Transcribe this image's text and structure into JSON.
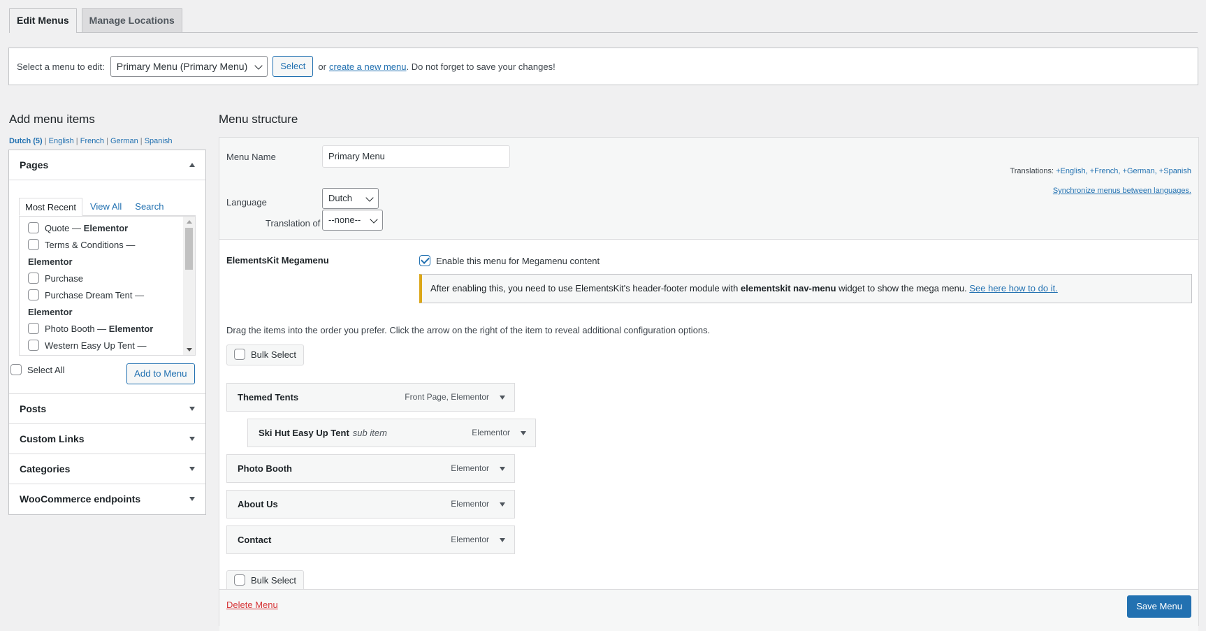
{
  "tabs": [
    {
      "label": "Edit Menus",
      "active": true
    },
    {
      "label": "Manage Locations",
      "active": false
    }
  ],
  "select_bar": {
    "label": "Select a menu to edit:",
    "selected_menu": "Primary Menu (Primary Menu)",
    "select_button": "Select",
    "or_text": "or",
    "create_link": "create a new menu",
    "reminder": ". Do not forget to save your changes!"
  },
  "left": {
    "title": "Add menu items",
    "languages": {
      "current": "Dutch (5)",
      "others": [
        "English",
        "French",
        "German",
        "Spanish"
      ]
    },
    "pages": {
      "title": "Pages",
      "tabs": [
        "Most Recent",
        "View All",
        "Search"
      ],
      "items": [
        {
          "text": "Quote",
          "suffix": "Elementor"
        },
        {
          "text": "Terms & Conditions —",
          "suffix": "Elementor"
        },
        {
          "text": "Purchase",
          "suffix": ""
        },
        {
          "text": "Purchase Dream Tent —",
          "suffix": "Elementor"
        },
        {
          "text": "Photo Booth",
          "suffix": "Elementor"
        },
        {
          "text": "Western Easy Up Tent —",
          "suffix": ""
        }
      ],
      "select_all": "Select All",
      "add_button": "Add to Menu"
    },
    "panels": [
      "Posts",
      "Custom Links",
      "Categories",
      "WooCommerce endpoints"
    ]
  },
  "right": {
    "title": "Menu structure",
    "menu_name_label": "Menu Name",
    "menu_name_value": "Primary Menu",
    "language_label": "Language",
    "language_value": "Dutch",
    "translation_of_label": "Translation of",
    "translation_of_value": "--none--",
    "translations_label": "Translations:",
    "translations": [
      "English,",
      "French,",
      "German,",
      "Spanish"
    ],
    "sync_link": "Synchronize menus between languages.",
    "megamenu": {
      "title": "ElementsKit Megamenu",
      "enable_label": "Enable this menu for Megamenu content",
      "enabled": true,
      "notice_pre": "After enabling this, you need to use ElementsKit's header-footer module with ",
      "notice_bold": "elementskit nav-menu",
      "notice_post": " widget to show the mega menu. ",
      "notice_link": "See here how to do it."
    },
    "drag_instructions": "Drag the items into the order you prefer. Click the arrow on the right of the item to reveal additional configuration options.",
    "bulk_select": "Bulk Select",
    "items": [
      {
        "title": "Themed Tents",
        "sub": "",
        "type": "Front Page, Elementor"
      },
      {
        "title": "Ski Hut Easy Up Tent",
        "sub": "sub item",
        "type": "Elementor"
      },
      {
        "title": "Photo Booth",
        "sub": "",
        "type": "Elementor"
      },
      {
        "title": "About Us",
        "sub": "",
        "type": "Elementor"
      },
      {
        "title": "Contact",
        "sub": "",
        "type": "Elementor"
      }
    ],
    "delete_menu": "Delete Menu",
    "save_menu": "Save Menu"
  }
}
